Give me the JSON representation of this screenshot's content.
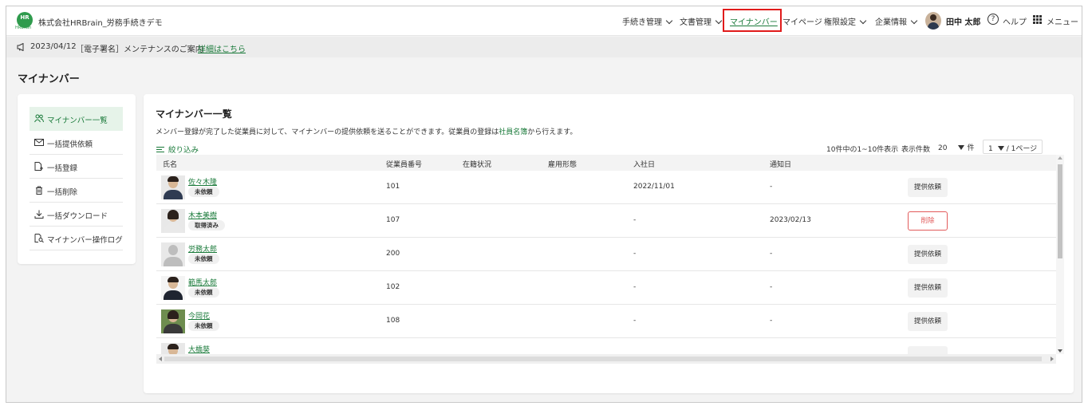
{
  "header": {
    "logo_text": "HR",
    "logo_sub": "HRBrain",
    "company": "株式会社HRBrain_労務手続きデモ",
    "nav": [
      {
        "label": "手続き管理"
      },
      {
        "label": "文書管理"
      },
      {
        "label": "マイナンバー"
      },
      {
        "label": "マイページ"
      },
      {
        "label": "権限設定"
      },
      {
        "label": "企業情報"
      }
    ],
    "user_name": "田中 太郎",
    "help_label": "ヘルプ",
    "menu_label": "メニュー"
  },
  "notice": {
    "date": "2023/04/12",
    "text": "［電子署名］メンテナンスのご案内",
    "link": "詳細はこちら"
  },
  "page_title": "マイナンバー",
  "sidebar": {
    "items": [
      {
        "label": "マイナンバー一覧",
        "icon": "people-icon"
      },
      {
        "label": "一括提供依頼",
        "icon": "mail-icon"
      },
      {
        "label": "一括登録",
        "icon": "file-add-icon"
      },
      {
        "label": "一括削除",
        "icon": "trash-icon"
      },
      {
        "label": "一括ダウンロード",
        "icon": "download-icon"
      },
      {
        "label": "マイナンバー操作ログ",
        "icon": "log-search-icon"
      }
    ]
  },
  "main": {
    "title": "マイナンバー一覧",
    "desc_before": "メンバー登録が完了した従業員に対して、マイナンバーの提供依頼を送ることができます。従業員の登録は",
    "desc_link": "社員名簿",
    "desc_after": "から行えます。",
    "filter_label": "絞り込み",
    "pager": {
      "range": "10件中の1~10件表示",
      "per_page_label": "表示件数",
      "per_page_value": "20",
      "per_page_unit": "件",
      "page_value": "1",
      "page_suffix": "/ 1ページ"
    },
    "columns": [
      "氏名",
      "従業員番号",
      "在籍状況",
      "雇用形態",
      "入社日",
      "通知日"
    ],
    "rows": [
      {
        "name": "佐々木隆",
        "status": "未依頼",
        "emp_no": "101",
        "join": "2022/11/01",
        "notify": "-",
        "action": "提供依頼"
      },
      {
        "name": "木本美樹",
        "status": "取得済み",
        "emp_no": "107",
        "join": "-",
        "notify": "2023/02/13",
        "action": "削除"
      },
      {
        "name": "労務太郎",
        "status": "未依頼",
        "emp_no": "200",
        "join": "-",
        "notify": "-",
        "action": "提供依頼"
      },
      {
        "name": "範馬太郎",
        "status": "未依頼",
        "emp_no": "102",
        "join": "-",
        "notify": "-",
        "action": "提供依頼"
      },
      {
        "name": "今岡花",
        "status": "未依頼",
        "emp_no": "108",
        "join": "-",
        "notify": "-",
        "action": "提供依頼"
      },
      {
        "name": "大橋葵",
        "status": "",
        "emp_no": "",
        "join": "",
        "notify": "",
        "action": ""
      }
    ]
  },
  "colors": {
    "accent": "#1a7a3a",
    "highlight": "#e01b1b",
    "danger": "#e25b5b"
  }
}
